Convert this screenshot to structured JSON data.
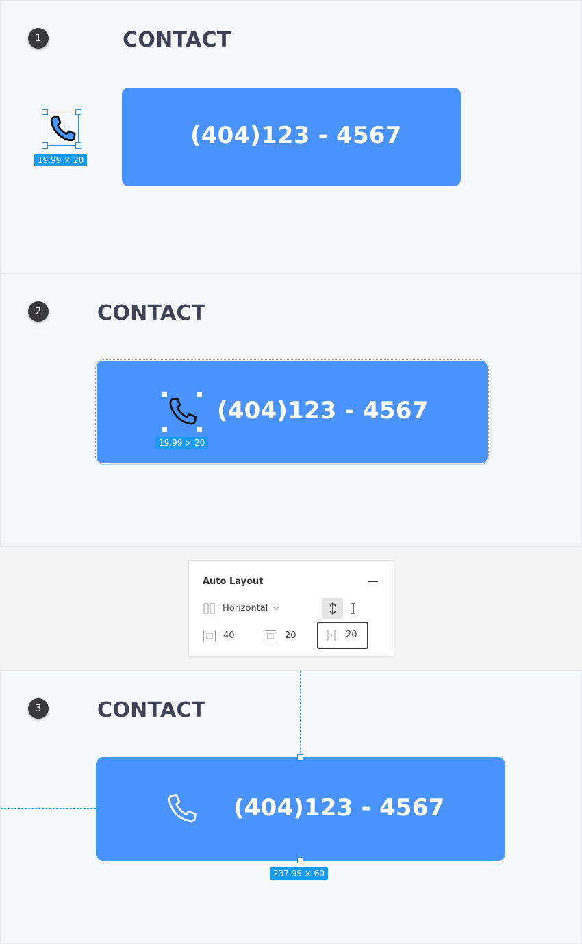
{
  "steps": [
    "1",
    "2",
    "3"
  ],
  "heading": "CONTACT",
  "phone": "(404)123 - 4567",
  "icon_dims": "19.99 × 20",
  "button_dims": "237.99 × 60",
  "auto_layout": {
    "title": "Auto Layout",
    "direction": "Horizontal",
    "horizontal_padding": "40",
    "vertical_padding": "20",
    "item_spacing": "20"
  },
  "colors": {
    "button": "#4a93fd",
    "heading": "#3d4256",
    "selection": "#1b9bef"
  },
  "icons": [
    "phone-icon",
    "minus-icon",
    "chevron-down-icon",
    "vertical-resize-icon",
    "text-cursor-icon",
    "horizontal-padding-icon",
    "vertical-padding-icon",
    "item-spacing-icon"
  ]
}
